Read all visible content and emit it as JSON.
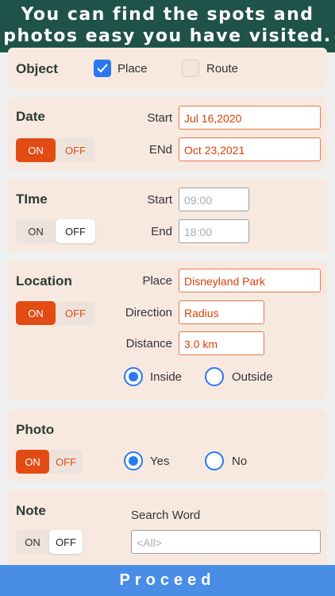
{
  "banner": {
    "line1": "You can find the spots and",
    "line2": "photos easy you have visited."
  },
  "object": {
    "label": "Object",
    "place": {
      "label": "Place",
      "checked": true
    },
    "route": {
      "label": "Route",
      "checked": false
    }
  },
  "date": {
    "label": "Date",
    "toggle": {
      "on": "ON",
      "off": "OFF",
      "state": "on"
    },
    "start_label": "Start",
    "start_value": "Jul 16,2020",
    "end_label": "ENd",
    "end_value": "Oct 23,2021"
  },
  "time": {
    "label": "TIme",
    "toggle": {
      "on": "ON",
      "off": "OFF",
      "state": "off"
    },
    "start_label": "Start",
    "start_value": "09:00",
    "end_label": "End",
    "end_value": "18:00"
  },
  "location": {
    "label": "Location",
    "toggle": {
      "on": "ON",
      "off": "OFF",
      "state": "on"
    },
    "place_label": "Place",
    "place_value": "Disneyland Park",
    "direction_label": "Direction",
    "direction_value": "Radius",
    "distance_label": "Distance",
    "distance_value": "3.0 km",
    "inside_label": "Inside",
    "outside_label": "Outside",
    "selected": "inside"
  },
  "photo": {
    "label": "Photo",
    "toggle": {
      "on": "ON",
      "off": "OFF",
      "state": "on"
    },
    "yes_label": "Yes",
    "no_label": "No",
    "selected": "yes"
  },
  "note": {
    "label": "Note",
    "toggle": {
      "on": "ON",
      "off": "OFF",
      "state": "off"
    },
    "search_label": "Search Word",
    "search_value": "<All>"
  },
  "proceed_label": "Proceed",
  "colors": {
    "banner": "#1f5248",
    "card": "#f7e9df",
    "accent": "#e24b14",
    "blue": "#2a78f0",
    "proceed": "#4a8de6"
  }
}
